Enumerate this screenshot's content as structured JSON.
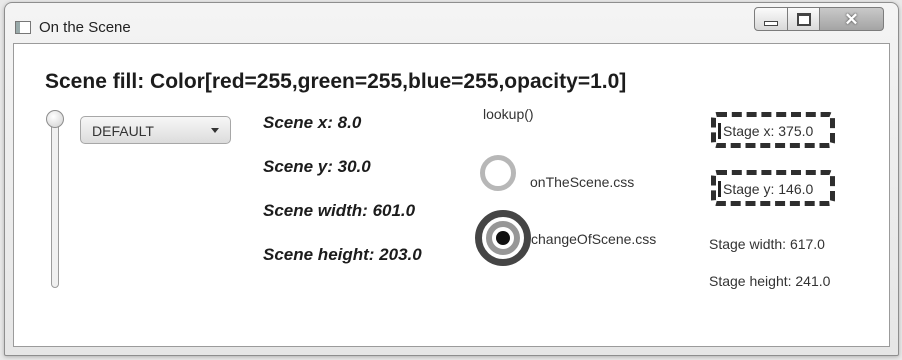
{
  "window": {
    "title": "On the Scene"
  },
  "scene_fill": "Scene fill: Color[red=255,green=255,blue=255,opacity=1.0]",
  "combo": {
    "value": "DEFAULT"
  },
  "slider": {
    "level": 0
  },
  "scene": {
    "x": "Scene x: 8.0",
    "y": "Scene y: 30.0",
    "width": "Scene width: 601.0",
    "height": "Scene height: 203.0"
  },
  "lookup_label": "lookup()",
  "radios": [
    {
      "label": "onTheScene.css",
      "selected": false
    },
    {
      "label": "changeOfScene.css",
      "selected": true
    }
  ],
  "stage": {
    "x": "Stage x: 375.0",
    "y": "Stage y: 146.0",
    "width": "Stage width: 617.0",
    "height": "Stage height: 241.0"
  }
}
